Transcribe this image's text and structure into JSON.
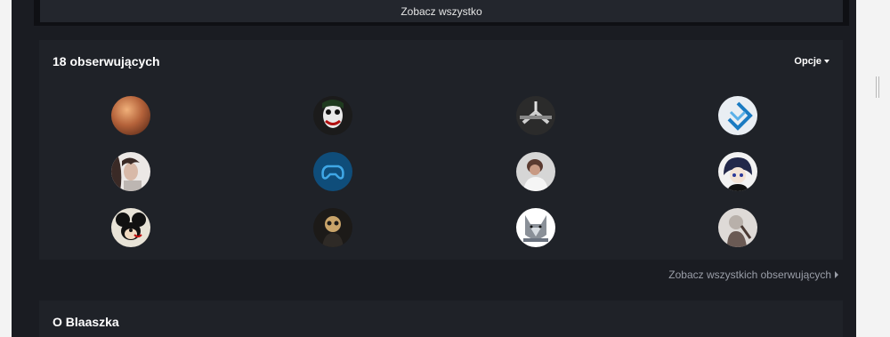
{
  "top": {
    "see_all_label": "Zobacz wszystko"
  },
  "followers": {
    "title": "18 obserwujących",
    "options_label": "Opcje",
    "see_all_label": "Zobacz wszystkich obserwujących",
    "avatars": [
      {
        "icon": "avatar-sunset-icon",
        "bg": "#b4623a"
      },
      {
        "icon": "avatar-joker-icon",
        "bg": "#1b1b1b"
      },
      {
        "icon": "avatar-anime-icon",
        "bg": "#2b2b2b"
      },
      {
        "icon": "avatar-logo-icon",
        "bg": "#e9eef3"
      },
      {
        "icon": "avatar-girl-icon",
        "bg": "#d9d4d2"
      },
      {
        "icon": "avatar-gamepad-icon",
        "bg": "#0f4d7a"
      },
      {
        "icon": "avatar-person-icon",
        "bg": "#cfcfcf"
      },
      {
        "icon": "avatar-anime-boy-icon",
        "bg": "#f2f2f2"
      },
      {
        "icon": "avatar-mouse-icon",
        "bg": "#e8e3d7"
      },
      {
        "icon": "avatar-skull-icon",
        "bg": "#2a2620"
      },
      {
        "icon": "avatar-wolf-icon",
        "bg": "#ffffff"
      },
      {
        "icon": "avatar-figure-icon",
        "bg": "#d7d3d0"
      }
    ]
  },
  "about": {
    "title": "O Blaaszka"
  }
}
